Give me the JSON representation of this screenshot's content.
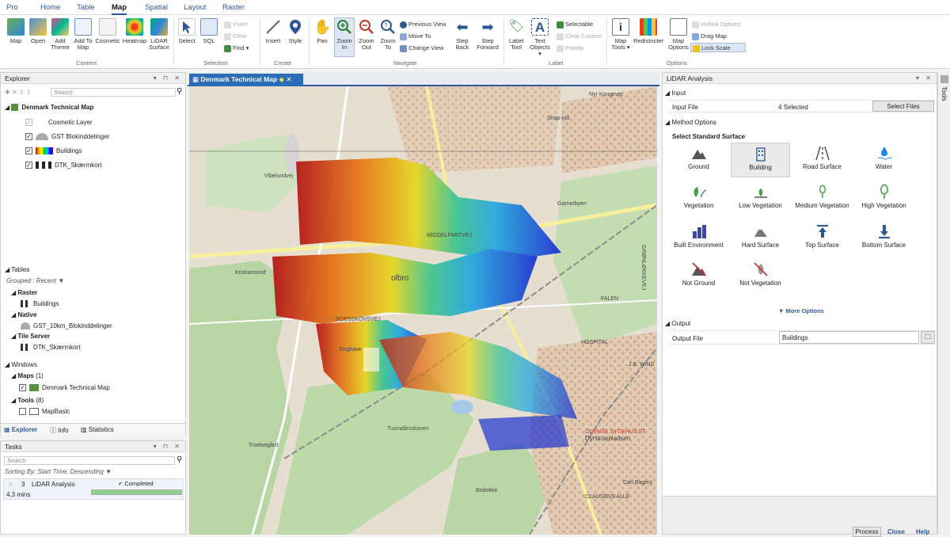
{
  "tabs": [
    "Pro",
    "Home",
    "Table",
    "Map",
    "Spatial",
    "Layout",
    "Raster"
  ],
  "ribbon": {
    "content": {
      "label": "Content",
      "buttons": [
        "Map",
        "Open",
        "Add Theme",
        "Add To Map",
        "Cosmetic",
        "Heatmap",
        "LiDAR Surface"
      ]
    },
    "selection": {
      "label": "Selection",
      "buttons": [
        "Select",
        "SQL"
      ],
      "small": [
        "Invert",
        "Clear",
        "Find"
      ]
    },
    "create": {
      "label": "Create",
      "buttons": [
        "Insert",
        "Style"
      ]
    },
    "navigate": {
      "label": "Navigate",
      "buttons": [
        "Pan",
        "Zoom In",
        "Zoom Out",
        "Zoom To"
      ],
      "small": [
        "Previous View",
        "Move To",
        "Change View"
      ],
      "buttons2": [
        "Step Back",
        "Step Forward"
      ]
    },
    "label": {
      "label": "Label",
      "buttons": [
        "Label Tool",
        "Text Objects"
      ],
      "small": [
        "Selectable",
        "Clear Custom",
        "Priority"
      ]
    },
    "options": {
      "label": "Options",
      "buttons": [
        "Map Tools",
        "Redistricter",
        "Map Options"
      ],
      "small": [
        "Hotlink Options",
        "Drag Map",
        "Lock Scale"
      ]
    }
  },
  "explorer": {
    "title": "Explorer",
    "search_placeholder": "Search",
    "map_name": "Denmark Technical Map",
    "layers": [
      "Cosmetic Layer",
      "GST Blokinddelinger",
      "Buildings",
      "DTK_Skærmkort"
    ],
    "tables_header": "Tables",
    "grouped": "Grouped : Recent",
    "groups": [
      {
        "name": "Raster",
        "item": "Buildings"
      },
      {
        "name": "Native",
        "item": "GST_10km_Blokinddelinger"
      },
      {
        "name": "Tile Server",
        "item": "DTK_Skærmkort"
      }
    ],
    "windows_header": "Windows",
    "maps_label": "Maps",
    "maps_count": "(1)",
    "map_item": "Denmark Technical Map",
    "tools_label": "Tools",
    "tools_count": "(8)",
    "tool_item": "MapBasic",
    "bottom_tabs": [
      "Explorer",
      "Info",
      "Statistics"
    ]
  },
  "tasks": {
    "title": "Tasks",
    "search_placeholder": "Search",
    "sorting": "Sorting By: Start Time, Descending",
    "task_num": "3",
    "task_name": "LiDAR Analysis",
    "status": "Completed",
    "duration": "4,3 mins",
    "progress": 1.0
  },
  "map": {
    "tab": "Denmark Technical Map",
    "labels": [
      "Snap-ind",
      "Vibelundvej",
      "Garnerbyen",
      "Kristiansund",
      "MIDDELFARTVEJ",
      "olbro",
      "Tusindårsskoven",
      "ROESSKOVSVEJ",
      "HOSPITAL",
      "J.B. WINS",
      "FALEN",
      "ODENSE SYGEHUS ST",
      "Dyrskuepladsen",
      "Carl Bagers",
      "CLAUSENS ALLÉ",
      "Brolokke",
      "Troelsegård",
      "Enghave",
      "Nyr Kongevej",
      "GRØNLØKKEVEJ"
    ]
  },
  "lidar": {
    "title": "LiDAR Analysis",
    "input_section": "Input",
    "input_file_label": "Input File",
    "input_file_value": "4  Selected",
    "select_files": "Select Files",
    "method_section": "Method Options",
    "surface_header": "Select Standard Surface",
    "surfaces": [
      "Ground",
      "Building",
      "Road Surface",
      "Water",
      "Vegetation",
      "Low Vegetation",
      "Medium Vegetation",
      "High Vegetation",
      "Built Environment",
      "Hard Surface",
      "Top Surface",
      "Bottom Surface",
      "Not Ground",
      "Not Vegetation"
    ],
    "more_options": "More Options",
    "output_section": "Output",
    "output_file_label": "Output File",
    "output_file_value": "Buildings",
    "footer": [
      "Process",
      "Close",
      "Help"
    ]
  },
  "side_tab": "Tools",
  "colors": {
    "accent": "#2b5797",
    "header_blue": "#2b6cb8"
  }
}
